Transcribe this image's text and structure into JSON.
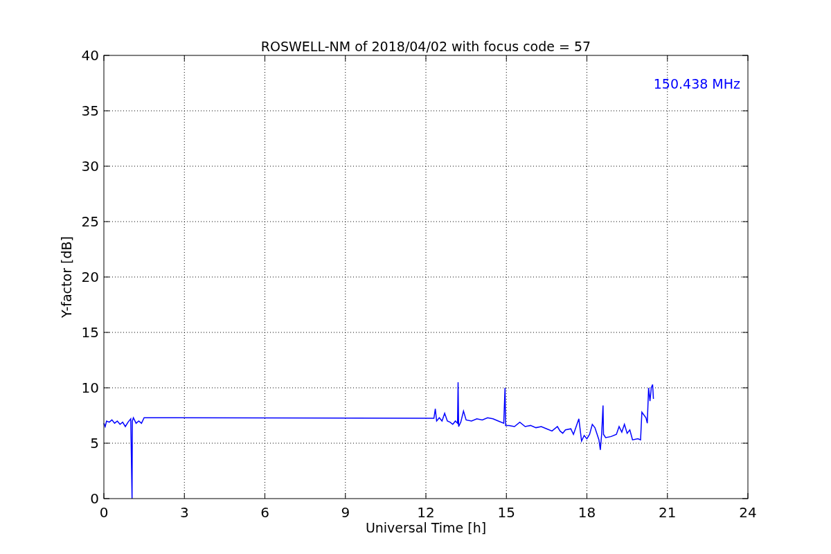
{
  "chart_data": {
    "type": "line",
    "title": "ROSWELL-NM of 2018/04/02 with focus code = 57",
    "xlabel": "Universal Time [h]",
    "ylabel": "Y-factor [dB]",
    "x": [
      0,
      0.05,
      0.1,
      0.2,
      0.3,
      0.4,
      0.5,
      0.6,
      0.7,
      0.8,
      0.9,
      1.0,
      1.05,
      1.06,
      1.1,
      1.2,
      1.3,
      1.4,
      1.5,
      12.3,
      12.35,
      12.4,
      12.5,
      12.6,
      12.7,
      12.8,
      12.9,
      13.0,
      13.1,
      13.18,
      13.2,
      13.22,
      13.3,
      13.4,
      13.5,
      13.7,
      13.9,
      14.1,
      14.3,
      14.5,
      14.7,
      14.9,
      14.95,
      14.97,
      15.1,
      15.3,
      15.5,
      15.7,
      15.9,
      16.1,
      16.3,
      16.5,
      16.7,
      16.9,
      17.0,
      17.1,
      17.2,
      17.4,
      17.5,
      17.6,
      17.7,
      17.8,
      17.9,
      18.0,
      18.1,
      18.2,
      18.3,
      18.45,
      18.5,
      18.55,
      18.6,
      18.62,
      18.7,
      18.9,
      19.1,
      19.2,
      19.3,
      19.4,
      19.5,
      19.6,
      19.7,
      19.9,
      20.0,
      20.05,
      20.2,
      20.25,
      20.3,
      20.35,
      20.4,
      20.45,
      20.48
    ],
    "series": [
      {
        "name": "150.438 MHz",
        "color": "#0000ff",
        "values": [
          6.8,
          6.5,
          7.0,
          6.9,
          7.1,
          6.8,
          7.0,
          6.7,
          6.9,
          6.5,
          6.9,
          7.2,
          0,
          7.0,
          7.3,
          6.8,
          7.0,
          6.8,
          7.3,
          7.25,
          8.1,
          7.0,
          7.3,
          7.0,
          7.7,
          7.0,
          6.9,
          6.7,
          7.0,
          6.8,
          10.5,
          6.5,
          6.9,
          7.9,
          7.1,
          7.0,
          7.2,
          7.1,
          7.3,
          7.2,
          7.0,
          6.8,
          10.0,
          6.6,
          6.6,
          6.5,
          6.9,
          6.5,
          6.6,
          6.4,
          6.5,
          6.3,
          6.1,
          6.5,
          6.1,
          5.9,
          6.2,
          6.3,
          5.8,
          6.5,
          7.2,
          5.2,
          5.7,
          5.4,
          5.8,
          6.7,
          6.4,
          5.3,
          4.4,
          5.8,
          8.4,
          5.8,
          5.5,
          5.6,
          5.8,
          6.5,
          6.0,
          6.7,
          5.9,
          6.2,
          5.3,
          5.4,
          5.3,
          7.8,
          7.3,
          6.8,
          10.0,
          8.8,
          10.0,
          10.3,
          9.0
        ]
      }
    ],
    "grid": true,
    "xlim": [
      0,
      24
    ],
    "ylim": [
      0,
      40
    ],
    "xticks": [
      0,
      3,
      6,
      9,
      12,
      15,
      18,
      21,
      24
    ],
    "yticks": [
      0,
      5,
      10,
      15,
      20,
      25,
      30,
      35,
      40
    ]
  }
}
